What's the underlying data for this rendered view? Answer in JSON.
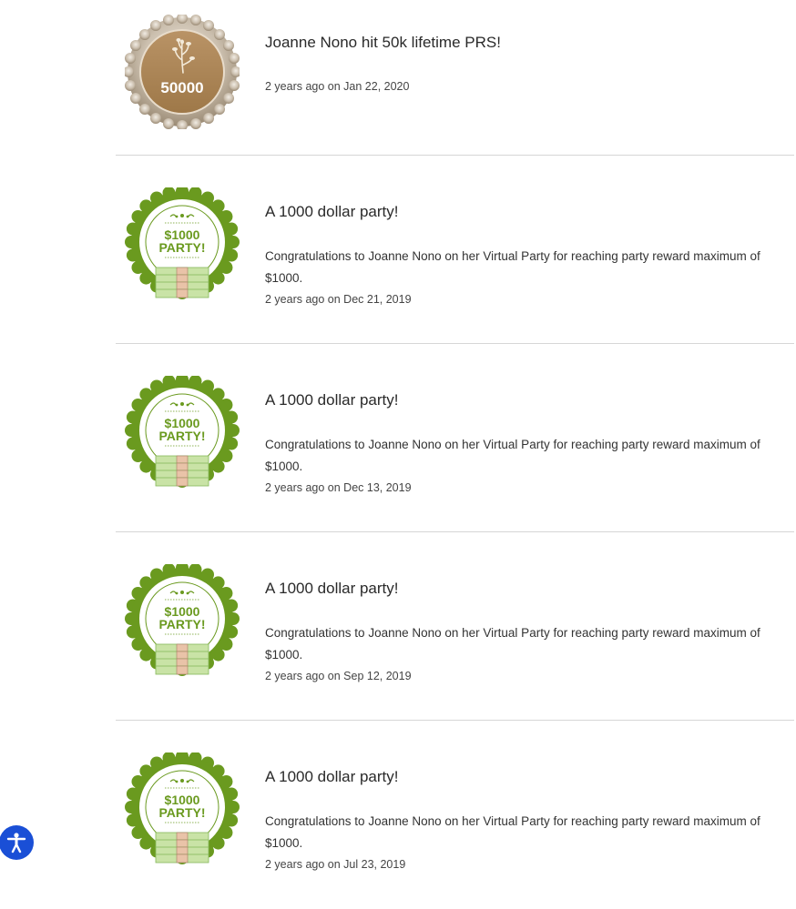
{
  "feed": {
    "entries": [
      {
        "badge": "50000",
        "badge_icon": "plant-sprig-icon",
        "title": "Joanne Nono hit 50k lifetime PRS!",
        "description": "",
        "date": "2 years ago on Jan 22, 2020"
      },
      {
        "badge": "$1000 PARTY!",
        "badge_top": "$1000",
        "badge_bottom": "PARTY!",
        "title": "A 1000 dollar party!",
        "description": "Congratulations to Joanne Nono on her Virtual Party for reaching party reward maximum of $1000.",
        "date": "2 years ago on Dec 21, 2019"
      },
      {
        "badge": "$1000 PARTY!",
        "badge_top": "$1000",
        "badge_bottom": "PARTY!",
        "title": "A 1000 dollar party!",
        "description": "Congratulations to Joanne Nono on her Virtual Party for reaching party reward maximum of $1000.",
        "date": "2 years ago on Dec 13, 2019"
      },
      {
        "badge": "$1000 PARTY!",
        "badge_top": "$1000",
        "badge_bottom": "PARTY!",
        "title": "A 1000 dollar party!",
        "description": "Congratulations to Joanne Nono on her Virtual Party for reaching party reward maximum of $1000.",
        "date": "2 years ago on Sep 12, 2019"
      },
      {
        "badge": "$1000 PARTY!",
        "badge_top": "$1000",
        "badge_bottom": "PARTY!",
        "title": "A 1000 dollar party!",
        "description": "Congratulations to Joanne Nono on her Virtual Party for reaching party reward maximum of $1000.",
        "date": "2 years ago on Jul 23, 2019"
      }
    ]
  },
  "accessibility": {
    "icon": "accessibility-person-icon",
    "color": "#1a4fd6"
  },
  "colors": {
    "gold_badge": "#a88455",
    "green_badge": "#6a9a1f",
    "money_green": "#c9e3a6"
  }
}
